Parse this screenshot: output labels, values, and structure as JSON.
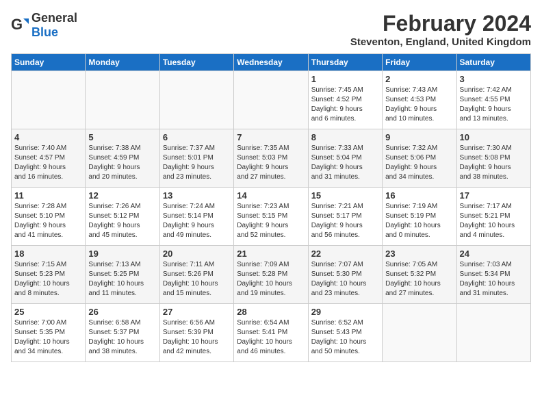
{
  "header": {
    "logo_general": "General",
    "logo_blue": "Blue",
    "month_year": "February 2024",
    "location": "Steventon, England, United Kingdom"
  },
  "days_of_week": [
    "Sunday",
    "Monday",
    "Tuesday",
    "Wednesday",
    "Thursday",
    "Friday",
    "Saturday"
  ],
  "weeks": [
    [
      {
        "day": "",
        "info": ""
      },
      {
        "day": "",
        "info": ""
      },
      {
        "day": "",
        "info": ""
      },
      {
        "day": "",
        "info": ""
      },
      {
        "day": "1",
        "info": "Sunrise: 7:45 AM\nSunset: 4:52 PM\nDaylight: 9 hours\nand 6 minutes."
      },
      {
        "day": "2",
        "info": "Sunrise: 7:43 AM\nSunset: 4:53 PM\nDaylight: 9 hours\nand 10 minutes."
      },
      {
        "day": "3",
        "info": "Sunrise: 7:42 AM\nSunset: 4:55 PM\nDaylight: 9 hours\nand 13 minutes."
      }
    ],
    [
      {
        "day": "4",
        "info": "Sunrise: 7:40 AM\nSunset: 4:57 PM\nDaylight: 9 hours\nand 16 minutes."
      },
      {
        "day": "5",
        "info": "Sunrise: 7:38 AM\nSunset: 4:59 PM\nDaylight: 9 hours\nand 20 minutes."
      },
      {
        "day": "6",
        "info": "Sunrise: 7:37 AM\nSunset: 5:01 PM\nDaylight: 9 hours\nand 23 minutes."
      },
      {
        "day": "7",
        "info": "Sunrise: 7:35 AM\nSunset: 5:03 PM\nDaylight: 9 hours\nand 27 minutes."
      },
      {
        "day": "8",
        "info": "Sunrise: 7:33 AM\nSunset: 5:04 PM\nDaylight: 9 hours\nand 31 minutes."
      },
      {
        "day": "9",
        "info": "Sunrise: 7:32 AM\nSunset: 5:06 PM\nDaylight: 9 hours\nand 34 minutes."
      },
      {
        "day": "10",
        "info": "Sunrise: 7:30 AM\nSunset: 5:08 PM\nDaylight: 9 hours\nand 38 minutes."
      }
    ],
    [
      {
        "day": "11",
        "info": "Sunrise: 7:28 AM\nSunset: 5:10 PM\nDaylight: 9 hours\nand 41 minutes."
      },
      {
        "day": "12",
        "info": "Sunrise: 7:26 AM\nSunset: 5:12 PM\nDaylight: 9 hours\nand 45 minutes."
      },
      {
        "day": "13",
        "info": "Sunrise: 7:24 AM\nSunset: 5:14 PM\nDaylight: 9 hours\nand 49 minutes."
      },
      {
        "day": "14",
        "info": "Sunrise: 7:23 AM\nSunset: 5:15 PM\nDaylight: 9 hours\nand 52 minutes."
      },
      {
        "day": "15",
        "info": "Sunrise: 7:21 AM\nSunset: 5:17 PM\nDaylight: 9 hours\nand 56 minutes."
      },
      {
        "day": "16",
        "info": "Sunrise: 7:19 AM\nSunset: 5:19 PM\nDaylight: 10 hours\nand 0 minutes."
      },
      {
        "day": "17",
        "info": "Sunrise: 7:17 AM\nSunset: 5:21 PM\nDaylight: 10 hours\nand 4 minutes."
      }
    ],
    [
      {
        "day": "18",
        "info": "Sunrise: 7:15 AM\nSunset: 5:23 PM\nDaylight: 10 hours\nand 8 minutes."
      },
      {
        "day": "19",
        "info": "Sunrise: 7:13 AM\nSunset: 5:25 PM\nDaylight: 10 hours\nand 11 minutes."
      },
      {
        "day": "20",
        "info": "Sunrise: 7:11 AM\nSunset: 5:26 PM\nDaylight: 10 hours\nand 15 minutes."
      },
      {
        "day": "21",
        "info": "Sunrise: 7:09 AM\nSunset: 5:28 PM\nDaylight: 10 hours\nand 19 minutes."
      },
      {
        "day": "22",
        "info": "Sunrise: 7:07 AM\nSunset: 5:30 PM\nDaylight: 10 hours\nand 23 minutes."
      },
      {
        "day": "23",
        "info": "Sunrise: 7:05 AM\nSunset: 5:32 PM\nDaylight: 10 hours\nand 27 minutes."
      },
      {
        "day": "24",
        "info": "Sunrise: 7:03 AM\nSunset: 5:34 PM\nDaylight: 10 hours\nand 31 minutes."
      }
    ],
    [
      {
        "day": "25",
        "info": "Sunrise: 7:00 AM\nSunset: 5:35 PM\nDaylight: 10 hours\nand 34 minutes."
      },
      {
        "day": "26",
        "info": "Sunrise: 6:58 AM\nSunset: 5:37 PM\nDaylight: 10 hours\nand 38 minutes."
      },
      {
        "day": "27",
        "info": "Sunrise: 6:56 AM\nSunset: 5:39 PM\nDaylight: 10 hours\nand 42 minutes."
      },
      {
        "day": "28",
        "info": "Sunrise: 6:54 AM\nSunset: 5:41 PM\nDaylight: 10 hours\nand 46 minutes."
      },
      {
        "day": "29",
        "info": "Sunrise: 6:52 AM\nSunset: 5:43 PM\nDaylight: 10 hours\nand 50 minutes."
      },
      {
        "day": "",
        "info": ""
      },
      {
        "day": "",
        "info": ""
      }
    ]
  ]
}
